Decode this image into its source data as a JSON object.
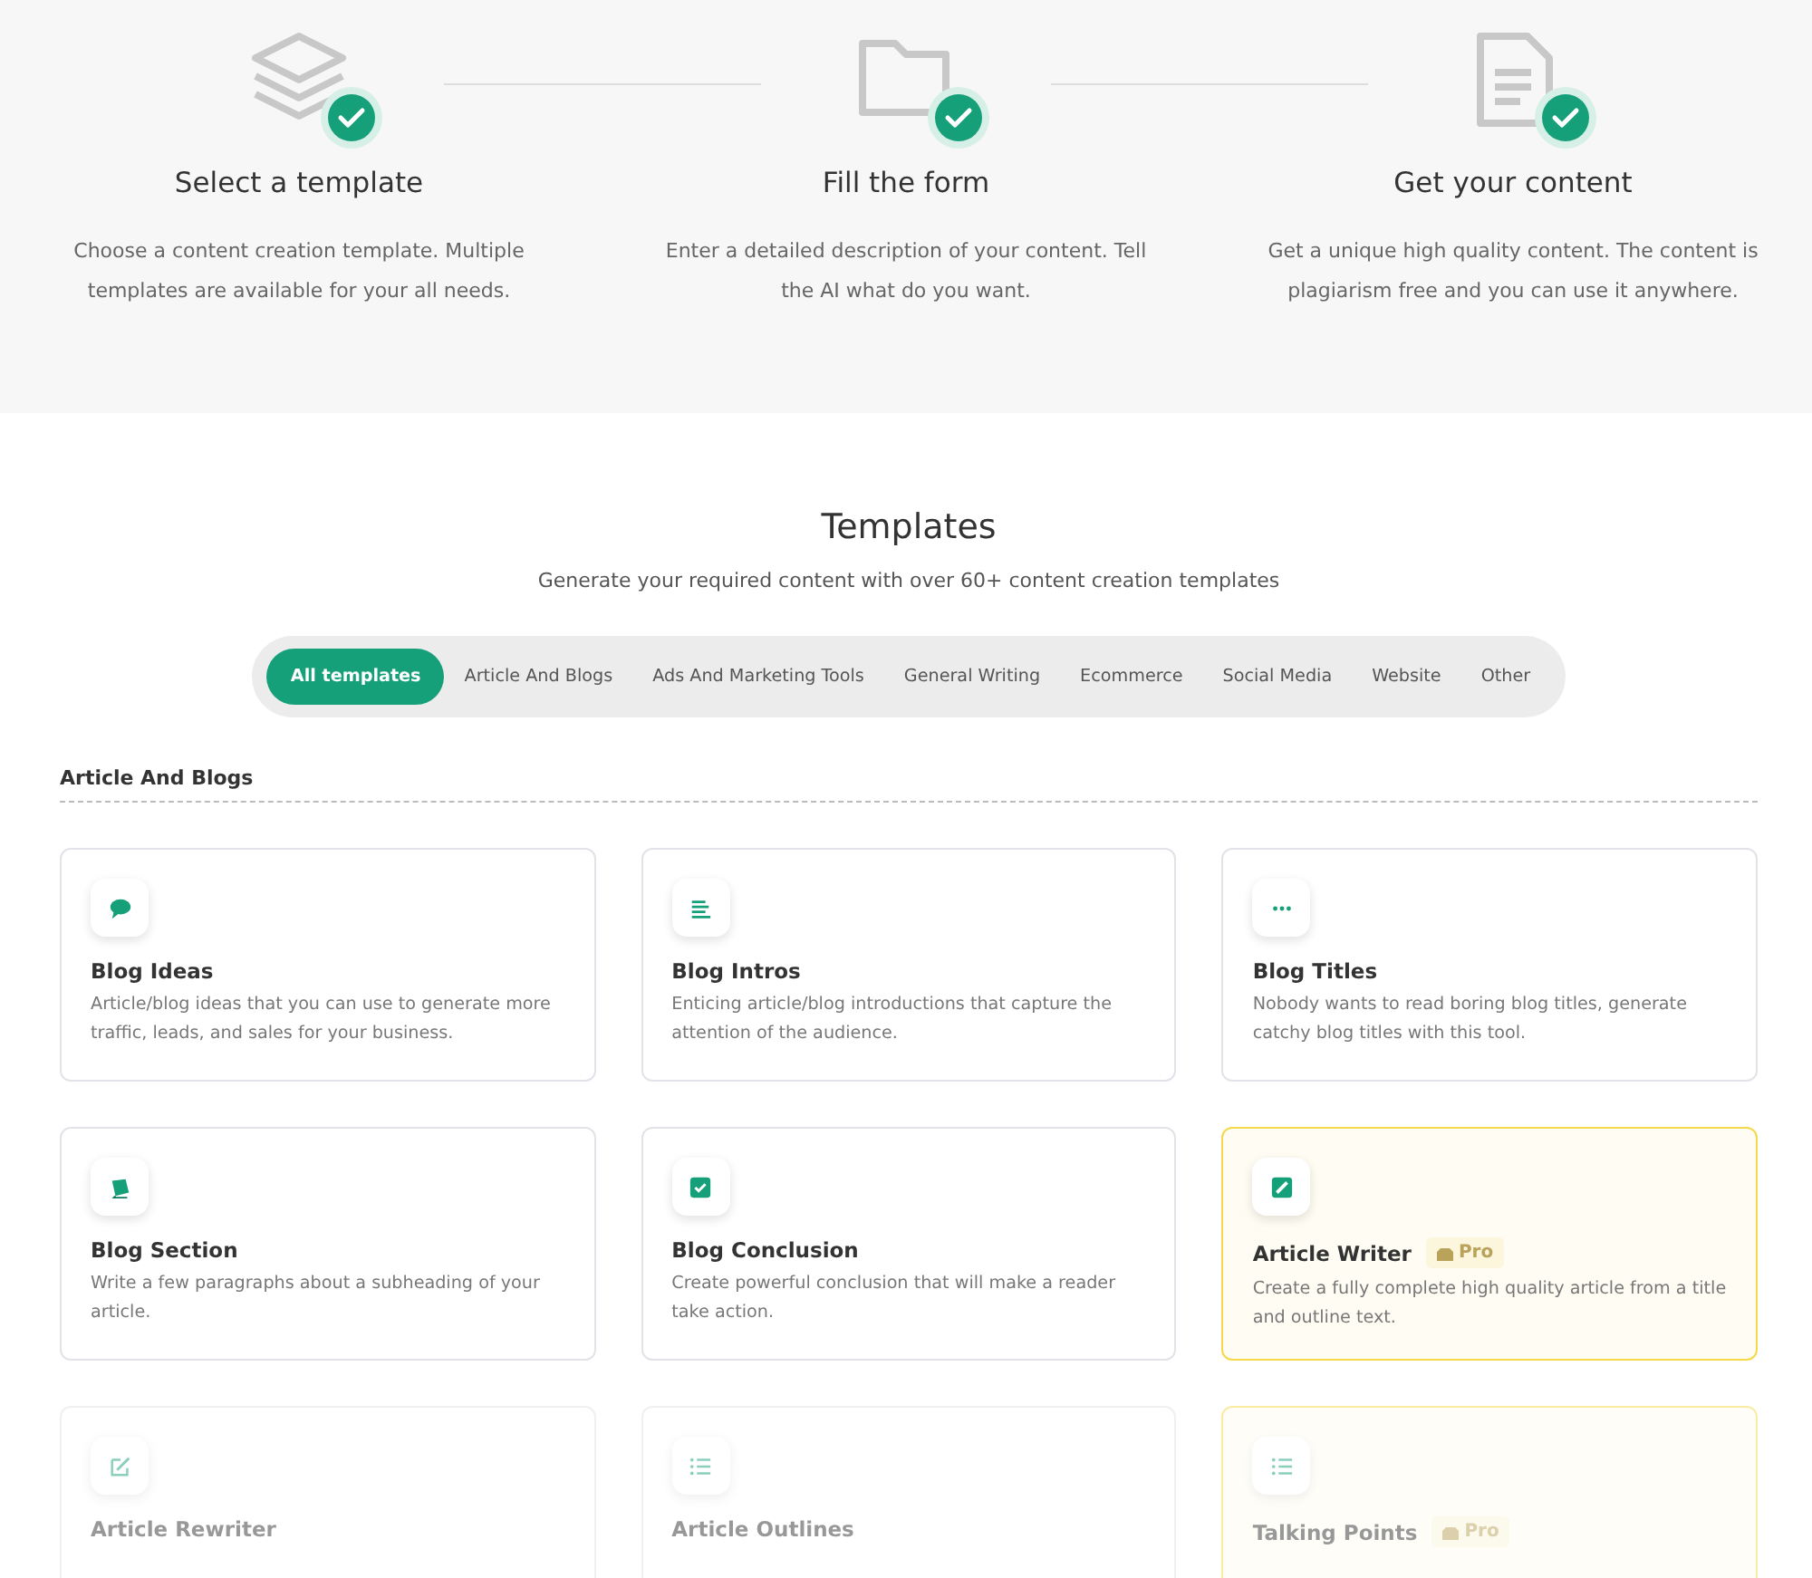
{
  "steps": [
    {
      "title": "Select a template",
      "description": "Choose a content creation template. Multiple templates are available for your all needs.",
      "done": true
    },
    {
      "title": "Fill the form",
      "description": "Enter a detailed description of your content. Tell the AI what do you want.",
      "done": true
    },
    {
      "title": "Get your content",
      "description": "Get a unique high quality content. The content is plagiarism free and you can use it anywhere.",
      "done": true
    }
  ],
  "templates": {
    "title": "Templates",
    "subtitle": "Generate your required content with over 60+ content creation templates",
    "tabs": [
      {
        "label": "All templates",
        "selected": true
      },
      {
        "label": "Article And Blogs",
        "selected": false
      },
      {
        "label": "Ads And Marketing Tools",
        "selected": false
      },
      {
        "label": "General Writing",
        "selected": false
      },
      {
        "label": "Ecommerce",
        "selected": false
      },
      {
        "label": "Social Media",
        "selected": false
      },
      {
        "label": "Website",
        "selected": false
      },
      {
        "label": "Other",
        "selected": false
      }
    ],
    "section": "Article And Blogs",
    "cards": [
      {
        "title": "Blog Ideas",
        "description": "Article/blog ideas that you can use to generate more traffic, leads, and sales for your business.",
        "pro": false,
        "faded": false
      },
      {
        "title": "Blog Intros",
        "description": "Enticing article/blog introductions that capture the attention of the audience.",
        "pro": false,
        "faded": false
      },
      {
        "title": "Blog Titles",
        "description": "Nobody wants to read boring blog titles, generate catchy blog titles with this tool.",
        "pro": false,
        "faded": false
      },
      {
        "title": "Blog Section",
        "description": "Write a few paragraphs about a subheading of your article.",
        "pro": false,
        "faded": false
      },
      {
        "title": "Blog Conclusion",
        "description": "Create powerful conclusion that will make a reader take action.",
        "pro": false,
        "faded": false
      },
      {
        "title": "Article Writer",
        "description": "Create a fully complete high quality article from a title and outline text.",
        "pro": true,
        "badge": "Pro",
        "faded": false
      },
      {
        "title": "Article Rewriter",
        "pro": false,
        "faded": true
      },
      {
        "title": "Article Outlines",
        "pro": false,
        "faded": true
      },
      {
        "title": "Talking Points",
        "pro": true,
        "badge": "Pro",
        "faded": true
      }
    ]
  }
}
